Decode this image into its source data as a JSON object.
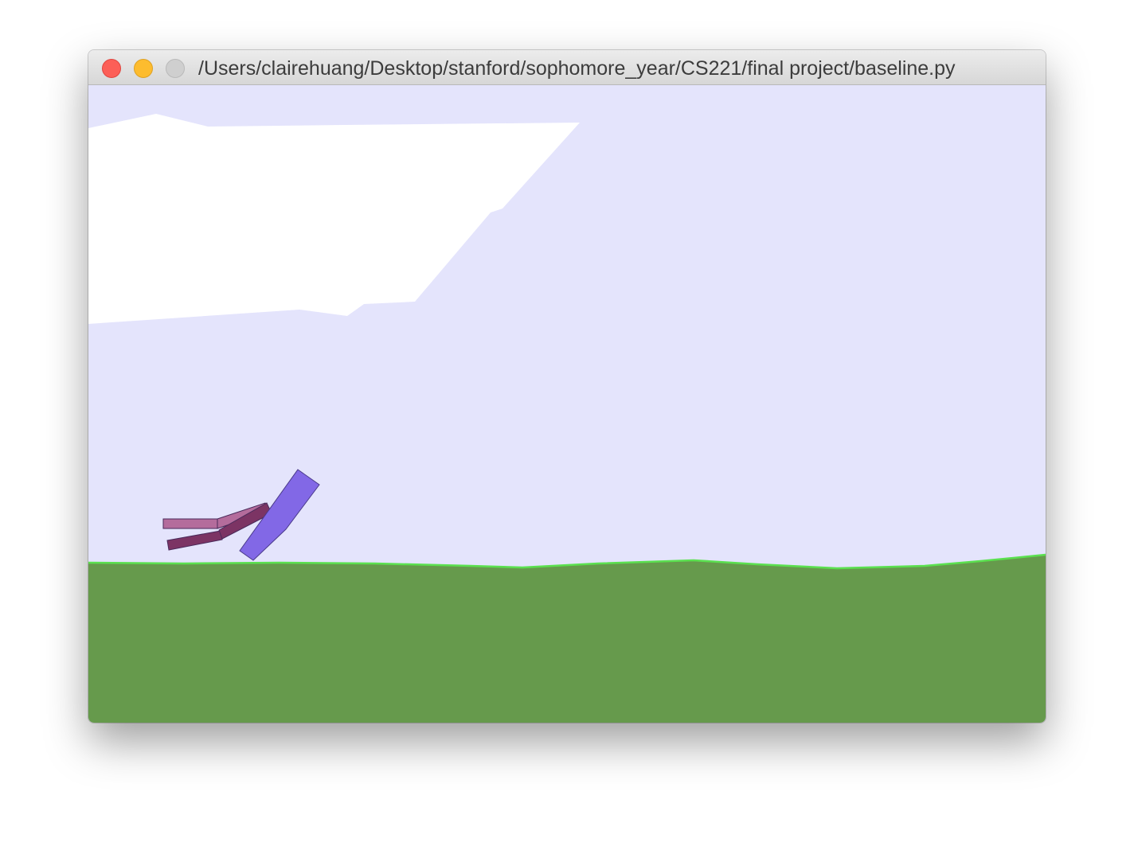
{
  "window": {
    "title": "/Users/clairehuang/Desktop/stanford/sophomore_year/CS221/final project/baseline.py",
    "buttons": [
      "close",
      "minimize",
      "zoom"
    ]
  },
  "scene": {
    "sky_color": "#e4e4fc",
    "cloud_color": "#ffffff",
    "terrain_fill_color": "#669a4c",
    "terrain_edge_color": "#5be04f",
    "hull_color": "#8268e6",
    "near_leg_color": "#b46c9c",
    "far_leg_color": "#7c3464",
    "outline_color": "#4a2a5a"
  }
}
